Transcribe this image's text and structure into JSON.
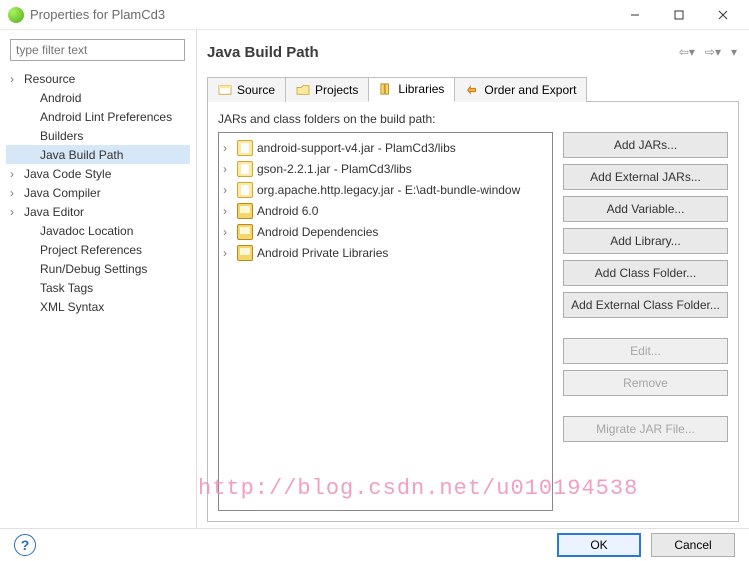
{
  "window": {
    "title": "Properties for PlamCd3"
  },
  "filter": {
    "placeholder": "type filter text"
  },
  "tree": [
    {
      "label": "Resource",
      "expandable": true,
      "indent": false
    },
    {
      "label": "Android",
      "expandable": false,
      "indent": true
    },
    {
      "label": "Android Lint Preferences",
      "expandable": false,
      "indent": true
    },
    {
      "label": "Builders",
      "expandable": false,
      "indent": true
    },
    {
      "label": "Java Build Path",
      "expandable": false,
      "indent": true,
      "selected": true
    },
    {
      "label": "Java Code Style",
      "expandable": true,
      "indent": false
    },
    {
      "label": "Java Compiler",
      "expandable": true,
      "indent": false
    },
    {
      "label": "Java Editor",
      "expandable": true,
      "indent": false
    },
    {
      "label": "Javadoc Location",
      "expandable": false,
      "indent": true
    },
    {
      "label": "Project References",
      "expandable": false,
      "indent": true
    },
    {
      "label": "Run/Debug Settings",
      "expandable": false,
      "indent": true
    },
    {
      "label": "Task Tags",
      "expandable": false,
      "indent": true
    },
    {
      "label": "XML Syntax",
      "expandable": false,
      "indent": true
    }
  ],
  "page": {
    "title": "Java Build Path"
  },
  "tabs": [
    {
      "label": "Source"
    },
    {
      "label": "Projects"
    },
    {
      "label": "Libraries",
      "active": true
    },
    {
      "label": "Order and Export"
    }
  ],
  "content": {
    "heading": "JARs and class folders on the build path:"
  },
  "jars": [
    {
      "label": "android-support-v4.jar - PlamCd3/libs",
      "kind": "jar"
    },
    {
      "label": "gson-2.2.1.jar - PlamCd3/libs",
      "kind": "jar"
    },
    {
      "label": "org.apache.http.legacy.jar - E:\\adt-bundle-window",
      "kind": "jar"
    },
    {
      "label": "Android 6.0",
      "kind": "lib"
    },
    {
      "label": "Android Dependencies",
      "kind": "lib"
    },
    {
      "label": "Android Private Libraries",
      "kind": "lib"
    }
  ],
  "buttons": {
    "add_jars": "Add JARs...",
    "add_ext_jars": "Add External JARs...",
    "add_var": "Add Variable...",
    "add_lib": "Add Library...",
    "add_cf": "Add Class Folder...",
    "add_ext_cf": "Add External Class Folder...",
    "edit": "Edit...",
    "remove": "Remove",
    "migrate": "Migrate JAR File..."
  },
  "footer": {
    "ok": "OK",
    "cancel": "Cancel"
  },
  "watermark": "http://blog.csdn.net/u010194538"
}
